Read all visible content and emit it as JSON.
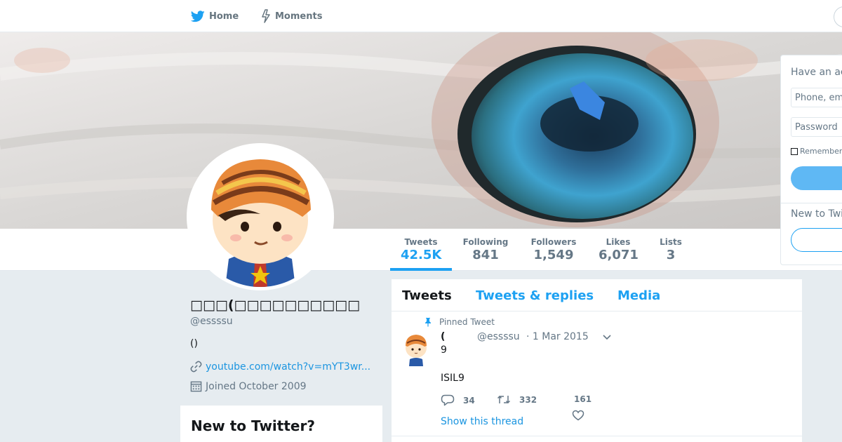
{
  "nav": {
    "home_label": "Home",
    "moments_label": "Moments"
  },
  "stats": [
    {
      "label": "Tweets",
      "value": "42.5K"
    },
    {
      "label": "Following",
      "value": "841"
    },
    {
      "label": "Followers",
      "value": "1,549"
    },
    {
      "label": "Likes",
      "value": "6,071"
    },
    {
      "label": "Lists",
      "value": "3"
    }
  ],
  "profile": {
    "name": "□□□(□□□□□□□□□□",
    "handle": "@essssu",
    "bio": "()",
    "link": "youtube.com/watch?v=mYT3wr...",
    "joined": "Joined October 2009"
  },
  "new_to_twitter_card": {
    "title": "New to Twitter?"
  },
  "timeline": {
    "tabs": [
      "Tweets",
      "Tweets & replies",
      "Media"
    ],
    "pinned_label": "Pinned Tweet",
    "tweet": {
      "name": "(",
      "handle": "@essssu",
      "date": "· 1 Mar 2015",
      "line1": "9",
      "line2": "ISIL9",
      "replies": "34",
      "retweets": "332",
      "likes": "161",
      "show_thread": "Show this thread"
    }
  },
  "login": {
    "title": "Have an account?",
    "phone_placeholder": "Phone, email or username",
    "password_placeholder": "Password",
    "remember_label": "Remember me",
    "new_label": "New to Twitter?"
  },
  "colors": {
    "accent": "#1da1f2",
    "link": "#1b95e0",
    "muted": "#657786",
    "background": "#e6ecf0"
  }
}
